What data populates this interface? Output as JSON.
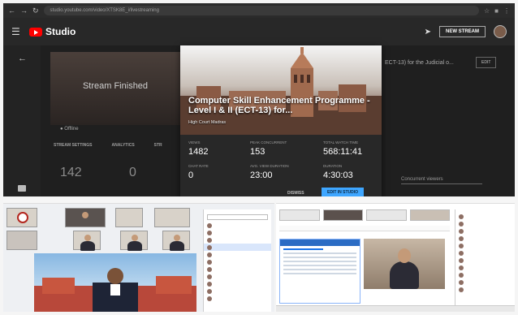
{
  "browser": {
    "url": "studio.youtube.com/video/XTSK8E_i/livestreaming"
  },
  "studio": {
    "title": "Studio",
    "new_stream_label": "NEW STREAM",
    "player_status": "Stream Finished",
    "status_label": "Offline",
    "tabs": [
      "STREAM SETTINGS",
      "ANALYTICS",
      "STR"
    ],
    "bg_stat_1": "142",
    "bg_stat_2": "0",
    "bg_title_snippet": "ECT-13) for the Judicial o...",
    "edit_label": "EDIT",
    "dropdown_placeholder": "Concurrent viewers"
  },
  "modal": {
    "title": "Computer Skill Enhancement Programme - Level I & II (ECT-13) for...",
    "channel": "High Court Madras",
    "stats": [
      {
        "label": "Views",
        "value": "1482"
      },
      {
        "label": "Peak concurrent",
        "value": "153"
      },
      {
        "label": "Total watch time",
        "value": "568:11:41"
      },
      {
        "label": "Chat rate",
        "value": "0"
      },
      {
        "label": "Avg. view duration",
        "value": "23:00"
      },
      {
        "label": "Duration",
        "value": "4:30:03"
      }
    ],
    "dismiss_label": "DISMISS",
    "edit_in_studio_label": "EDIT IN STUDIO"
  },
  "colors": {
    "youtube_red": "#ff0000",
    "studio_bg": "#1f1f1f",
    "accent_blue": "#3ea6ff"
  }
}
